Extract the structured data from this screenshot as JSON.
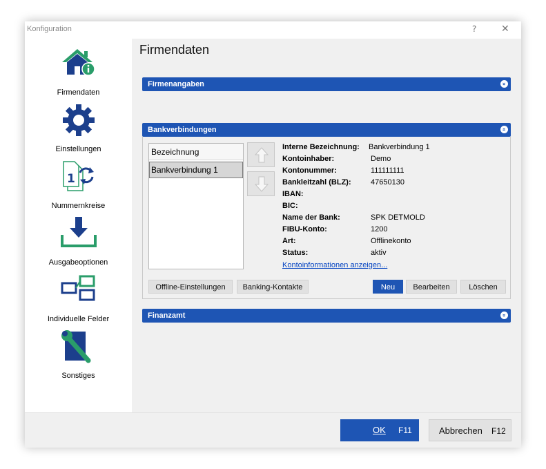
{
  "window": {
    "title": "Konfiguration",
    "help": "?",
    "close": "✕"
  },
  "sidebar": {
    "items": [
      {
        "label": "Firmendaten",
        "icon": "house-info-icon"
      },
      {
        "label": "Einstellungen",
        "icon": "gear-icon"
      },
      {
        "label": "Nummernkreise",
        "icon": "numbering-documents-icon"
      },
      {
        "label": "Ausgabeoptionen",
        "icon": "download-tray-icon"
      },
      {
        "label": "Individuelle Felder",
        "icon": "fields-boxes-icon"
      },
      {
        "label": "Sonstiges",
        "icon": "wrench-icon"
      }
    ]
  },
  "main": {
    "title": "Firmendaten",
    "sections": {
      "firmenangaben": {
        "label": "Firmenangaben",
        "toggle": "»"
      },
      "bankverbindungen": {
        "label": "Bankverbindungen",
        "toggle": "«"
      },
      "finanzamt": {
        "label": "Finanzamt",
        "toggle": "»"
      }
    },
    "bank": {
      "list_header": "Bezeichnung",
      "list_items": [
        "Bankverbindung 1"
      ],
      "details": [
        {
          "label": "Interne Bezeichnung:",
          "value": "Bankverbindung 1"
        },
        {
          "label": "Kontoinhaber:",
          "value": "Demo"
        },
        {
          "label": "Kontonummer:",
          "value": "111111111"
        },
        {
          "label": "Bankleitzahl (BLZ):",
          "value": "47650130"
        },
        {
          "label": "IBAN:",
          "value": ""
        },
        {
          "label": "BIC:",
          "value": ""
        },
        {
          "label": "Name der Bank:",
          "value": "SPK DETMOLD"
        },
        {
          "label": "FIBU-Konto:",
          "value": "1200"
        },
        {
          "label": "Art:",
          "value": "Offlinekonto"
        },
        {
          "label": "Status:",
          "value": "aktiv"
        }
      ],
      "link": "Kontoinformationen anzeigen...",
      "buttons": {
        "offline": "Offline-Einstellungen",
        "banking": "Banking-Kontakte",
        "neu": "Neu",
        "bearbeiten": "Bearbeiten",
        "loeschen": "Löschen"
      }
    }
  },
  "footer": {
    "ok": {
      "label": "OK",
      "key": "F11"
    },
    "cancel": {
      "label": "Abbrechen",
      "key": "F12"
    }
  },
  "colors": {
    "accent": "#1e55b4",
    "icon_green": "#2a9d6a",
    "icon_navy": "#1c3f8c"
  }
}
